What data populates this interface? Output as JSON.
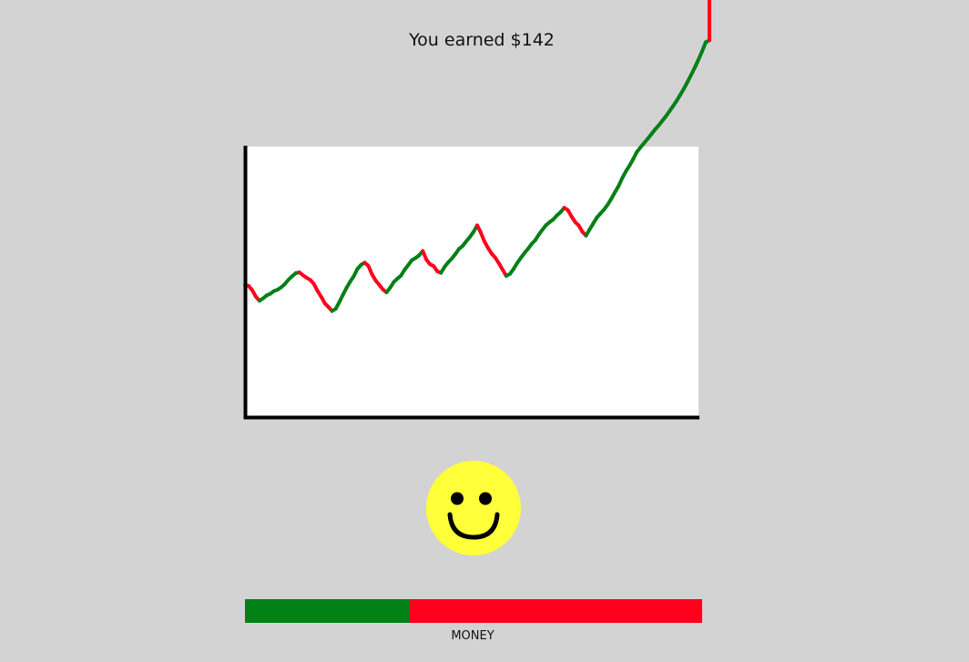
{
  "title": "You earned $142",
  "chart_data": {
    "type": "line",
    "series_colors": {
      "rising": "#008015",
      "falling": "#ff001e"
    },
    "x": [
      0,
      4,
      8,
      12,
      16,
      20,
      24,
      28,
      32,
      36,
      40,
      44,
      48,
      52,
      56,
      60,
      64,
      68,
      72,
      76,
      80,
      84,
      88,
      92,
      96,
      100,
      104,
      108,
      112,
      116,
      120,
      124,
      128,
      132,
      136,
      140,
      144,
      148,
      152,
      156,
      160,
      164,
      168,
      172,
      176,
      180,
      184,
      188,
      192,
      196,
      200,
      204,
      208,
      212,
      216,
      220,
      224,
      228,
      232,
      236,
      240,
      244,
      248,
      252,
      256,
      260,
      264,
      268,
      272,
      276,
      280,
      284,
      288,
      292,
      296,
      300,
      304,
      308,
      312,
      316,
      320,
      324,
      328,
      332,
      336,
      340,
      344,
      348,
      352,
      356,
      360,
      364,
      368,
      372,
      376,
      380,
      384,
      388,
      392,
      396,
      400,
      404,
      408,
      412,
      416,
      420,
      424,
      428,
      432,
      436,
      440,
      444,
      448,
      452,
      456,
      460,
      464,
      468,
      472,
      476,
      480,
      484,
      488,
      492,
      496,
      500,
      504,
      508,
      512,
      512
    ],
    "y": [
      48.8,
      48.5,
      46.9,
      44.5,
      43.0,
      43.9,
      45.0,
      45.6,
      46.6,
      47.1,
      48.0,
      49.2,
      50.8,
      52.1,
      53.2,
      53.5,
      52.4,
      51.5,
      50.7,
      49.2,
      46.6,
      44.5,
      42.1,
      40.7,
      39.2,
      40.0,
      42.5,
      45.2,
      47.8,
      50.1,
      52.1,
      54.8,
      56.3,
      57.1,
      55.9,
      52.8,
      50.5,
      48.9,
      47.2,
      46.1,
      47.8,
      49.9,
      51.2,
      52.3,
      54.5,
      56.2,
      58.0,
      58.8,
      59.8,
      61.4,
      58.2,
      56.5,
      55.8,
      53.9,
      53.3,
      55.5,
      57.2,
      58.6,
      60.3,
      62.2,
      63.3,
      65.0,
      66.6,
      68.5,
      70.9,
      68.2,
      64.9,
      62.5,
      60.4,
      58.9,
      56.8,
      54.5,
      52.2,
      52.9,
      54.7,
      56.9,
      58.8,
      60.6,
      62.2,
      64.0,
      65.4,
      67.5,
      69.3,
      71.0,
      72.1,
      73.1,
      74.6,
      75.8,
      77.4,
      76.5,
      74.2,
      72.1,
      70.8,
      68.5,
      67.1,
      69.4,
      71.6,
      73.8,
      75.3,
      76.8,
      78.6,
      80.8,
      83.2,
      85.5,
      88.4,
      90.9,
      93.0,
      95.4,
      98.0,
      99.7,
      101.3,
      102.9,
      104.6,
      106.3,
      107.8,
      109.5,
      111.2,
      113.1,
      115.0,
      117.0,
      119.2,
      121.5,
      124.0,
      126.6,
      129.3,
      132.2,
      135.3,
      138.6,
      139.3
    ],
    "xlim": [
      0,
      500
    ],
    "ylim": [
      0,
      100
    ],
    "xlabel": "",
    "ylabel": ""
  },
  "mood": {
    "icon": "smiley-face-icon",
    "color": "#ffff3a"
  },
  "money_meter": {
    "label": "MONEY",
    "level": 0.36,
    "fill_color": "#008015",
    "track_color": "#ff001e"
  }
}
